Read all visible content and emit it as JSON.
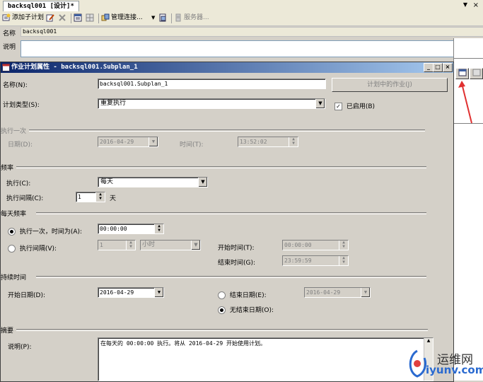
{
  "doc_tab": {
    "title": "backsql001 [设计]*",
    "close": "×",
    "dropdown": "▼"
  },
  "toolbar": {
    "add_subplan": "添加子计划",
    "manage_connections": "管理连接...",
    "servers": "服务器..."
  },
  "plan": {
    "name_label": "名称",
    "name_value": "backsql001",
    "desc_label": "说明"
  },
  "dialog": {
    "title": "作业计划属性 - backsql001.Subplan_1",
    "name_label": "名称(N):",
    "name_value": "backsql001.Subplan_1",
    "jobs_in_schedule": "计划中的作业(J)",
    "schedule_type_label": "计划类型(S):",
    "schedule_type_value": "重复执行",
    "enabled_label": "已启用(B)",
    "one_time": {
      "section": "执行一次",
      "date_label": "日期(D):",
      "date_value": "2016-04-29",
      "time_label": "时间(T):",
      "time_value": "13:52:02"
    },
    "frequency": {
      "section": "频率",
      "occurs_label": "执行(C):",
      "occurs_value": "每天",
      "recurs_label": "执行间隔(C):",
      "recurs_value": "1",
      "recurs_unit": "天"
    },
    "daily": {
      "section": "每天频率",
      "once_label": "执行一次，时间为(A):",
      "once_value": "00:00:00",
      "every_label": "执行间隔(V):",
      "every_value": "1",
      "every_unit": "小时",
      "start_label": "开始时间(T):",
      "start_value": "00:00:00",
      "end_label": "结束时间(G):",
      "end_value": "23:59:59"
    },
    "duration": {
      "section": "持续时间",
      "start_date_label": "开始日期(D):",
      "start_date_value": "2016-04-29",
      "end_date_label": "结束日期(E):",
      "end_date_value": "2016-04-29",
      "no_end_label": "无结束日期(O):"
    },
    "summary": {
      "section": "摘要",
      "desc_label": "说明(P):",
      "desc_value": "在每天的 00:00:00 执行。将从 2016-04-29 开始使用计划。"
    }
  },
  "watermark": {
    "cn": "运维网",
    "url": "iyunv.com"
  },
  "colors": {
    "title_start": "#0a246a",
    "title_end": "#a6caf0",
    "arrow": "#e03030"
  }
}
